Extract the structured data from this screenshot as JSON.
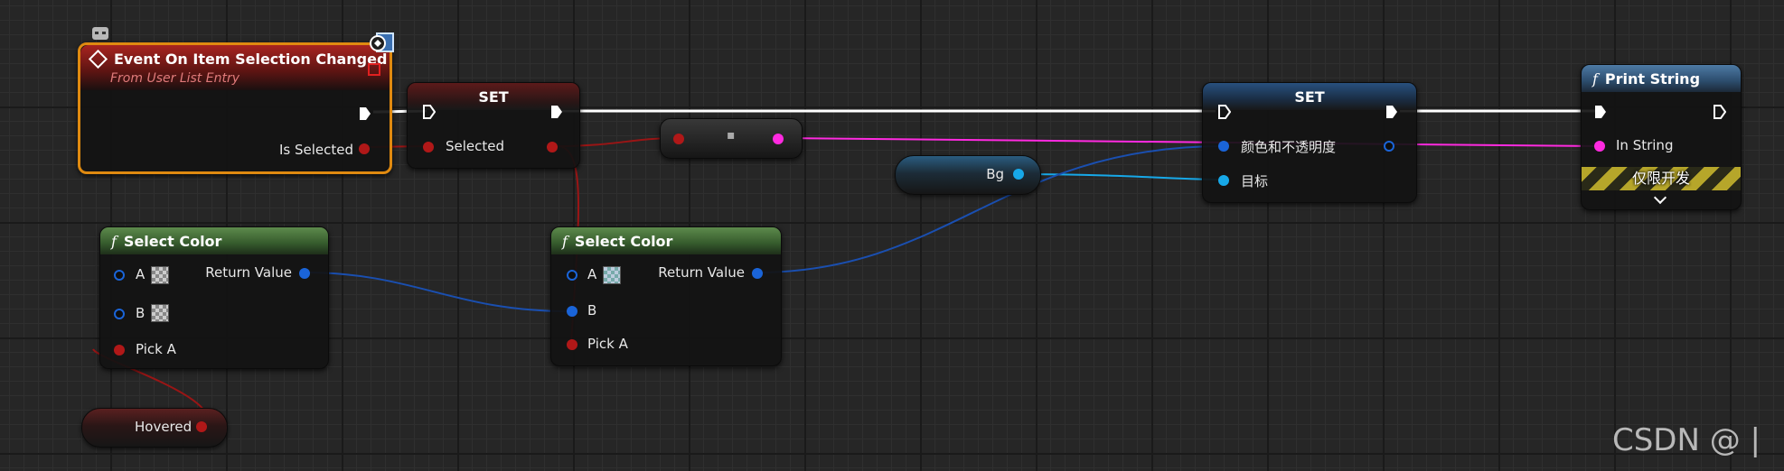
{
  "colors": {
    "exec": "#ffffff",
    "bool": "#b01818",
    "linear_color": "#1a64d8",
    "object": "#17a8e8",
    "string": "#ff2ae0",
    "event_outline": "#e08a10"
  },
  "event_node": {
    "title": "Event On Item Selection Changed",
    "subtitle": "From User List Entry",
    "output_label": "Is Selected",
    "icon": "event-diamond-icon",
    "badge_icon": "interface-message-icon",
    "comment_icon": "comment-bubble-icon"
  },
  "set_node_1": {
    "title": "SET",
    "pin_label": "Selected"
  },
  "to_string_node": {
    "glyph": "▪"
  },
  "bg_node": {
    "label": "Bg"
  },
  "set_node_2": {
    "title": "SET",
    "pin_color": "颜色和不透明度",
    "pin_target": "目标"
  },
  "print_node": {
    "title": "Print String",
    "glyph": "f",
    "pin_in_string": "In String",
    "dev_only": "仅限开发",
    "expand_icon": "chevron-down-icon"
  },
  "select_color_1": {
    "title": "Select Color",
    "glyph": "f",
    "pin_a": "A",
    "pin_b": "B",
    "pin_pick": "Pick A",
    "return": "Return Value"
  },
  "select_color_2": {
    "title": "Select Color",
    "glyph": "f",
    "pin_a": "A",
    "pin_b": "B",
    "pin_pick": "Pick A",
    "return": "Return Value"
  },
  "hovered_node": {
    "label": "Hovered"
  },
  "watermark": "CSDN @ |"
}
